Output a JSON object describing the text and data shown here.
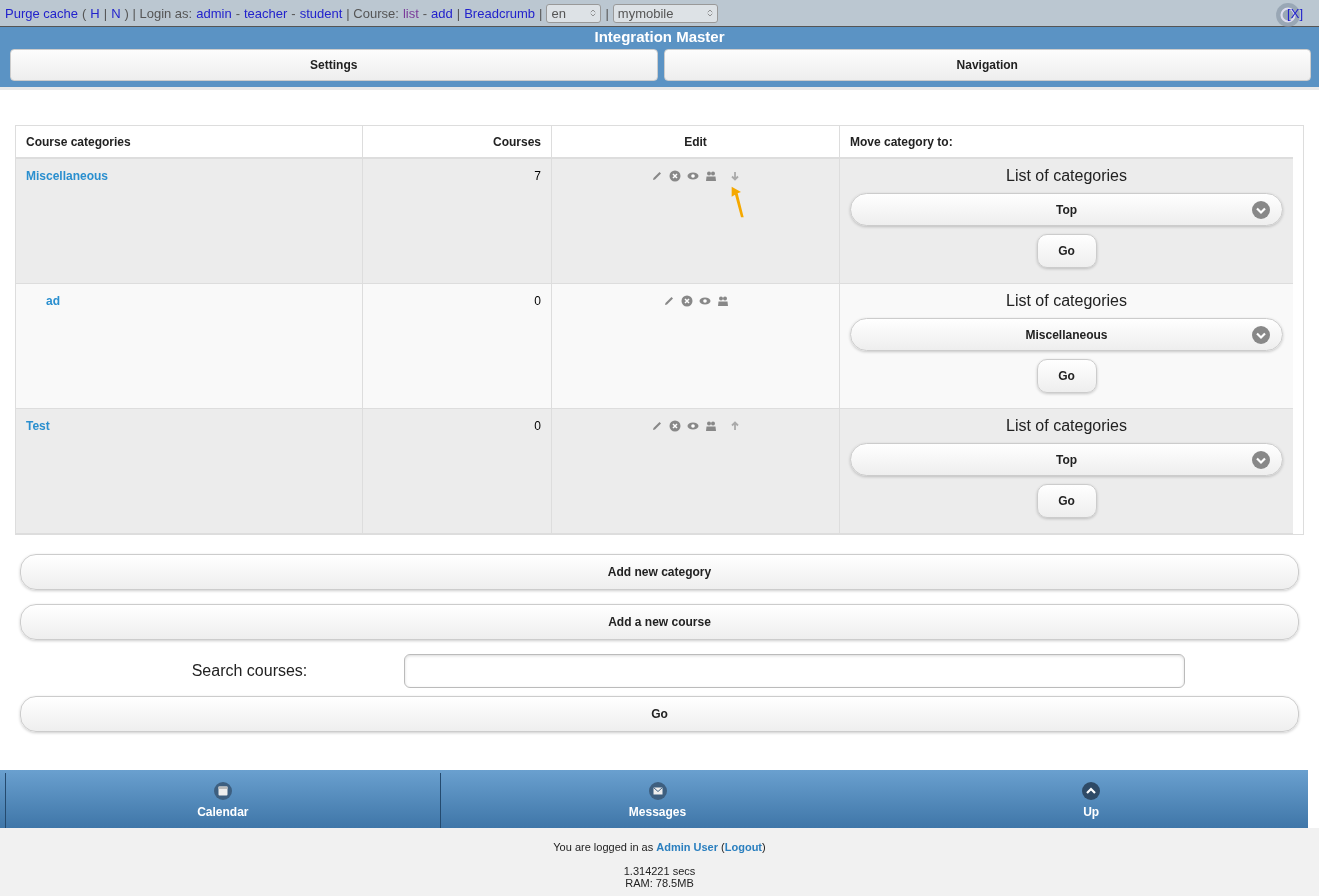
{
  "debug_bar": {
    "segments": [
      {
        "kind": "link",
        "text": "Purge cache"
      },
      {
        "kind": "plain",
        "text": "("
      },
      {
        "kind": "link",
        "text": "H"
      },
      {
        "kind": "plain",
        "text": "|"
      },
      {
        "kind": "link",
        "text": "N"
      },
      {
        "kind": "plain",
        "text": ") | Login as:"
      },
      {
        "kind": "link",
        "text": "admin"
      },
      {
        "kind": "plain",
        "text": "-"
      },
      {
        "kind": "link",
        "text": "teacher"
      },
      {
        "kind": "plain",
        "text": "-"
      },
      {
        "kind": "link",
        "text": "student"
      },
      {
        "kind": "plain",
        "text": "| Course:"
      },
      {
        "kind": "visited",
        "text": "list"
      },
      {
        "kind": "plain",
        "text": "-"
      },
      {
        "kind": "link",
        "text": "add"
      },
      {
        "kind": "plain",
        "text": "|"
      },
      {
        "kind": "link",
        "text": "Breadcrumb"
      },
      {
        "kind": "plain",
        "text": "|"
      },
      {
        "kind": "select",
        "text": "en"
      },
      {
        "kind": "plain",
        "text": "|"
      },
      {
        "kind": "select",
        "text": "mymobile"
      }
    ],
    "close": "[X]"
  },
  "header": {
    "title": "Integration Master",
    "buttons": [
      "Settings",
      "Navigation"
    ]
  },
  "table": {
    "columns": [
      "Course categories",
      "Courses",
      "Edit",
      "Move category to:"
    ],
    "rows": [
      {
        "name": "Miscellaneous",
        "courses": "7",
        "icons": [
          {
            "kind": "edit"
          },
          {
            "kind": "delete"
          },
          {
            "kind": "visible"
          },
          {
            "kind": "roles"
          },
          {
            "kind": "down"
          }
        ],
        "move_label": "List of categories",
        "move_value": "Top",
        "go": "Go",
        "children": [
          {
            "name": "ad",
            "courses": "0",
            "icons": [
              {
                "kind": "edit"
              },
              {
                "kind": "delete"
              },
              {
                "kind": "visible"
              },
              {
                "kind": "roles"
              }
            ],
            "move_label": "List of categories",
            "move_value": "Miscellaneous",
            "go": "Go"
          }
        ]
      },
      {
        "name": "Test",
        "courses": "0",
        "icons": [
          {
            "kind": "edit"
          },
          {
            "kind": "delete"
          },
          {
            "kind": "visible"
          },
          {
            "kind": "roles"
          },
          {
            "kind": "up"
          }
        ],
        "move_label": "List of categories",
        "move_value": "Top",
        "go": "Go"
      }
    ]
  },
  "actions": [
    "Add new category",
    "Add a new course"
  ],
  "search": {
    "label": "Search courses:",
    "go": "Go"
  },
  "navbar": [
    {
      "kind": "calendar",
      "label": "Calendar"
    },
    {
      "kind": "messages",
      "label": "Messages"
    },
    {
      "kind": "up",
      "label": "Up"
    }
  ],
  "footer": {
    "prefix": "You are logged in as",
    "user": "Admin User",
    "open": "(",
    "logout": "Logout",
    "close": ")",
    "time": "1.314221 secs",
    "ram": "RAM: 78.5MB"
  }
}
